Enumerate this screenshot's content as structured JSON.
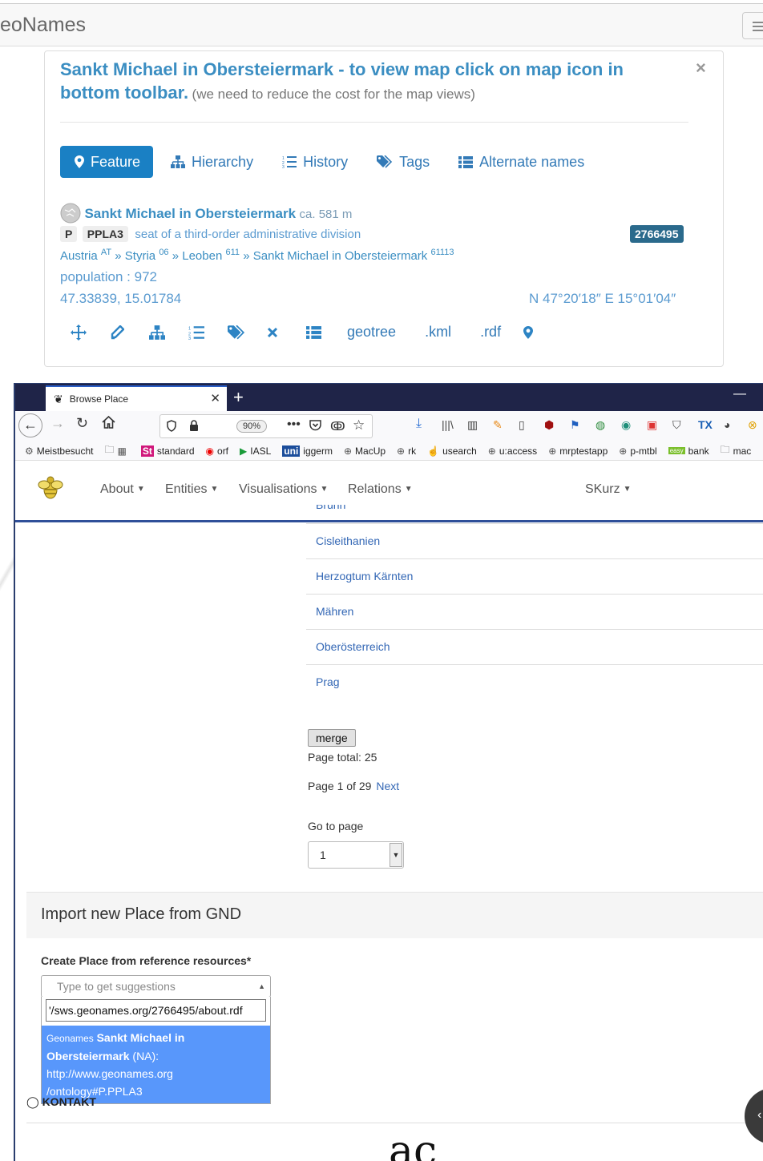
{
  "geonames": {
    "brand": "eoNames",
    "panel": {
      "title_bold": "Sankt Michael in Obersteiermark - to view map click on map icon in bottom toolbar.",
      "title_note": "(we need to reduce the cost for the map views)",
      "close": "×",
      "tabs": [
        {
          "label": "Feature",
          "icon": "map-marker-icon",
          "active": true
        },
        {
          "label": "Hierarchy",
          "icon": "sitemap-icon",
          "active": false
        },
        {
          "label": "History",
          "icon": "list-ordered-icon",
          "active": false
        },
        {
          "label": "Tags",
          "icon": "tags-icon",
          "active": false
        },
        {
          "label": "Alternate names",
          "icon": "list-icon",
          "active": false
        }
      ],
      "place_name": "Sankt Michael in Obersteiermark",
      "elevation": "ca. 581 m",
      "feature_class": "P",
      "feature_code": "PPLA3",
      "feature_desc": "seat of a third-order administrative division",
      "geoname_id": "2766495",
      "hierarchy": [
        {
          "name": "Austria",
          "code": "AT"
        },
        {
          "name": "Styria",
          "code": "06"
        },
        {
          "name": "Leoben",
          "code": "611"
        },
        {
          "name": "Sankt Michael in Obersteiermark",
          "code": "61113"
        }
      ],
      "separator": "»",
      "population": "population : 972",
      "latlon": "47.33839, 15.01784",
      "dms": "N 47°20′18″ E 15°01′04″",
      "toolbar_text": [
        "geotree",
        ".kml",
        ".rdf"
      ]
    }
  },
  "browser": {
    "tab_title": "Browse Place",
    "zoom": "90%",
    "bookmarks": [
      "Meistbesucht",
      "standard",
      "orf",
      "IASL",
      "iggerm",
      "MacUp",
      "rk",
      "usearch",
      "u:access",
      "mrptestapp",
      "p-mtbl",
      "bank",
      "mac"
    ]
  },
  "app": {
    "menu": [
      "About",
      "Entities",
      "Visualisations",
      "Relations"
    ],
    "user": "SKurz",
    "places": [
      "Brünn",
      "Cisleithanien",
      "Herzogtum Kärnten",
      "Mähren",
      "Oberösterreich",
      "Prag"
    ],
    "merge_label": "merge",
    "page_total": "Page total: 25",
    "page_of": "Page 1 of 29",
    "next": "Next",
    "goto_label": "Go to page",
    "goto_value": "1",
    "import_title": "Import new Place from GND",
    "create_label": "Create Place from reference resources*",
    "select_placeholder": "Type to get suggestions",
    "search_value": "'/sws.geonames.org/2766495/about.rdf",
    "result_source": "Geonames",
    "result_name": "Sankt Michael in Obersteiermark",
    "result_rest": "(NA): http://www.geonames.org /ontology#P.PPLA3",
    "kontakt": "KONTAKT",
    "footer_logo": "ac"
  }
}
